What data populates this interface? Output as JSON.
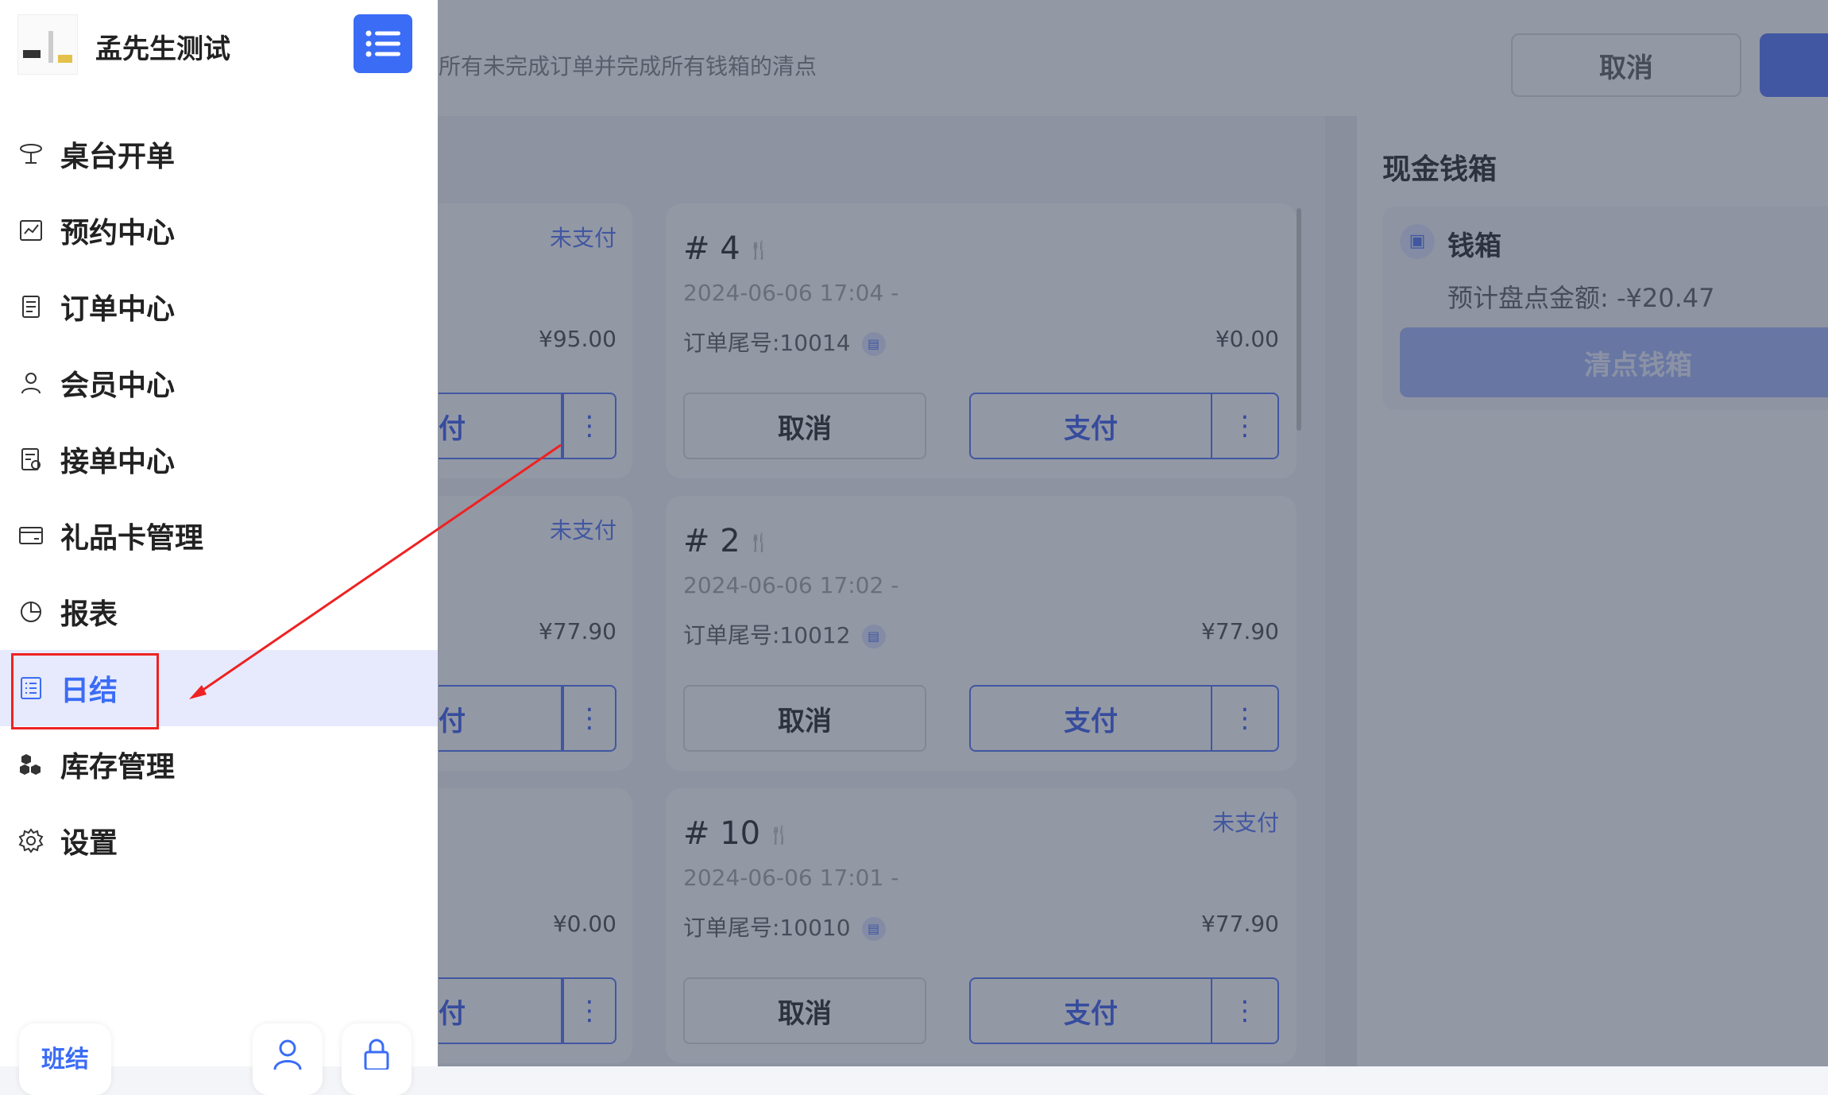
{
  "store": {
    "name": "孟先生测试"
  },
  "header": {
    "hint": "所有未完成订单并完成所有钱箱的清点",
    "cancel_label": "取消"
  },
  "left_cards": [
    {
      "status": "未支付",
      "amount": "¥95.00",
      "pay_label": "付",
      "more": "⋮"
    },
    {
      "status": "未支付",
      "amount": "¥77.90",
      "pay_label": "付",
      "more": "⋮"
    },
    {
      "status": "",
      "amount": "¥0.00",
      "pay_label": "付",
      "more": "⋮"
    }
  ],
  "orders": [
    {
      "number": "# 4",
      "time": "2024-06-06 17:04  -",
      "tail": "订单尾号:10014",
      "amount": "¥0.00",
      "status": "",
      "cancel_label": "取消",
      "pay_label": "支付",
      "more": "⋮"
    },
    {
      "number": "# 2",
      "time": "2024-06-06 17:02  -",
      "tail": "订单尾号:10012",
      "amount": "¥77.90",
      "status": "",
      "cancel_label": "取消",
      "pay_label": "支付",
      "more": "⋮"
    },
    {
      "number": "# 10",
      "time": "2024-06-06 17:01  -",
      "tail": "订单尾号:10010",
      "amount": "¥77.90",
      "status": "未支付",
      "cancel_label": "取消",
      "pay_label": "支付",
      "more": "⋮"
    }
  ],
  "cash": {
    "title": "现金钱箱",
    "box_name": "钱箱",
    "expected": "预计盘点金额: -¥20.47",
    "button": "清点钱箱"
  },
  "nav": [
    {
      "label": "桌台开单",
      "icon": "table-icon"
    },
    {
      "label": "预约中心",
      "icon": "reservation-icon"
    },
    {
      "label": "订单中心",
      "icon": "order-icon"
    },
    {
      "label": "会员中心",
      "icon": "member-icon"
    },
    {
      "label": "接单中心",
      "icon": "accept-order-icon"
    },
    {
      "label": "礼品卡管理",
      "icon": "gift-card-icon"
    },
    {
      "label": "报表",
      "icon": "report-icon"
    },
    {
      "label": "日结",
      "icon": "daily-close-icon"
    },
    {
      "label": "库存管理",
      "icon": "inventory-icon"
    },
    {
      "label": "设置",
      "icon": "settings-icon"
    }
  ],
  "footer": {
    "shift_label": "班结"
  },
  "colors": {
    "accent": "#3b6cf6",
    "active_bg": "#e6eafc",
    "highlight": "#ee2222"
  }
}
